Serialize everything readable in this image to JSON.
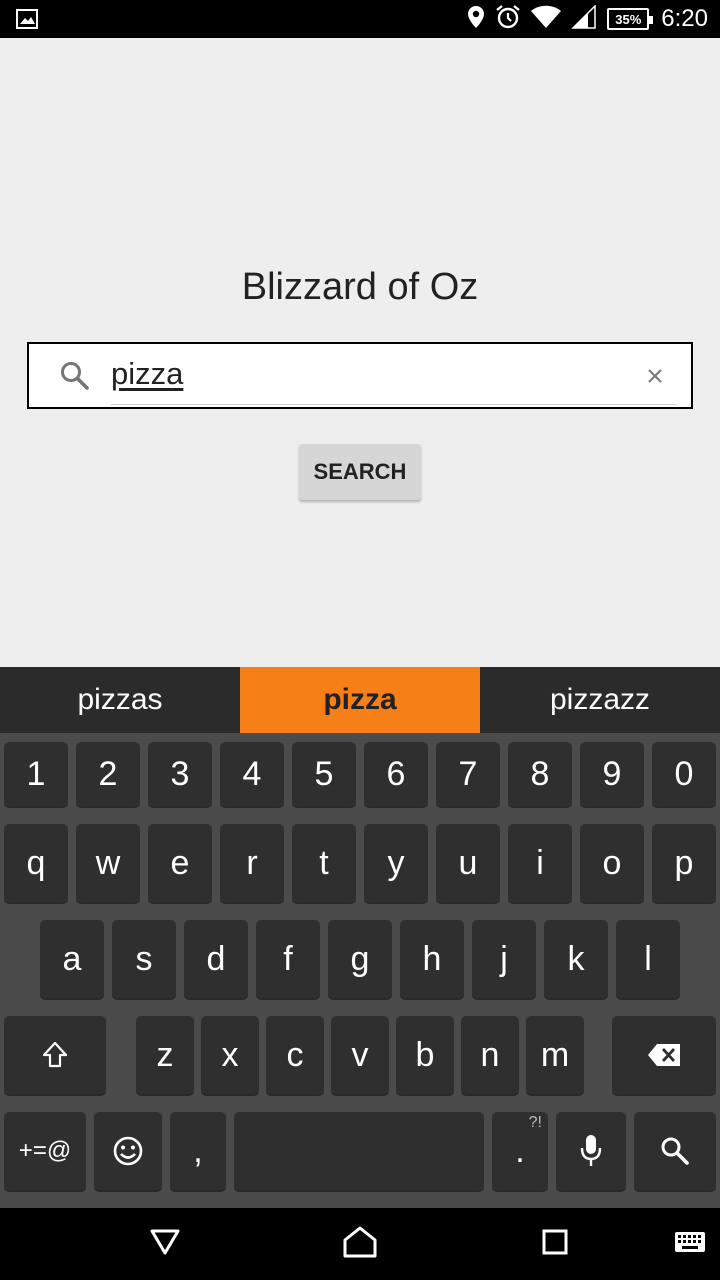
{
  "status_bar": {
    "time": "6:20",
    "battery": "35%",
    "icons": [
      "image-icon",
      "location-icon",
      "alarm-icon",
      "wifi-icon",
      "signal-icon",
      "battery-icon"
    ]
  },
  "app": {
    "title": "Blizzard of Oz",
    "search": {
      "value": "pizza",
      "placeholder": ""
    },
    "search_button": "SEARCH"
  },
  "keyboard": {
    "suggestions": [
      "pizzas",
      "pizza",
      "pizzazz"
    ],
    "suggestion_active": 1,
    "row_numbers": [
      "1",
      "2",
      "3",
      "4",
      "5",
      "6",
      "7",
      "8",
      "9",
      "0"
    ],
    "row_top": [
      "q",
      "w",
      "e",
      "r",
      "t",
      "y",
      "u",
      "i",
      "o",
      "p"
    ],
    "row_home": [
      "a",
      "s",
      "d",
      "f",
      "g",
      "h",
      "j",
      "k",
      "l"
    ],
    "row_bottom": [
      "z",
      "x",
      "c",
      "v",
      "b",
      "n",
      "m"
    ],
    "symbols_label": "+=@",
    "comma": ",",
    "period": ".",
    "period_hint": "?!",
    "accent_color": "#f77f18"
  },
  "nav_bar": {
    "icons": [
      "back-icon",
      "home-icon",
      "recents-icon",
      "keyboard-switch-icon"
    ]
  }
}
